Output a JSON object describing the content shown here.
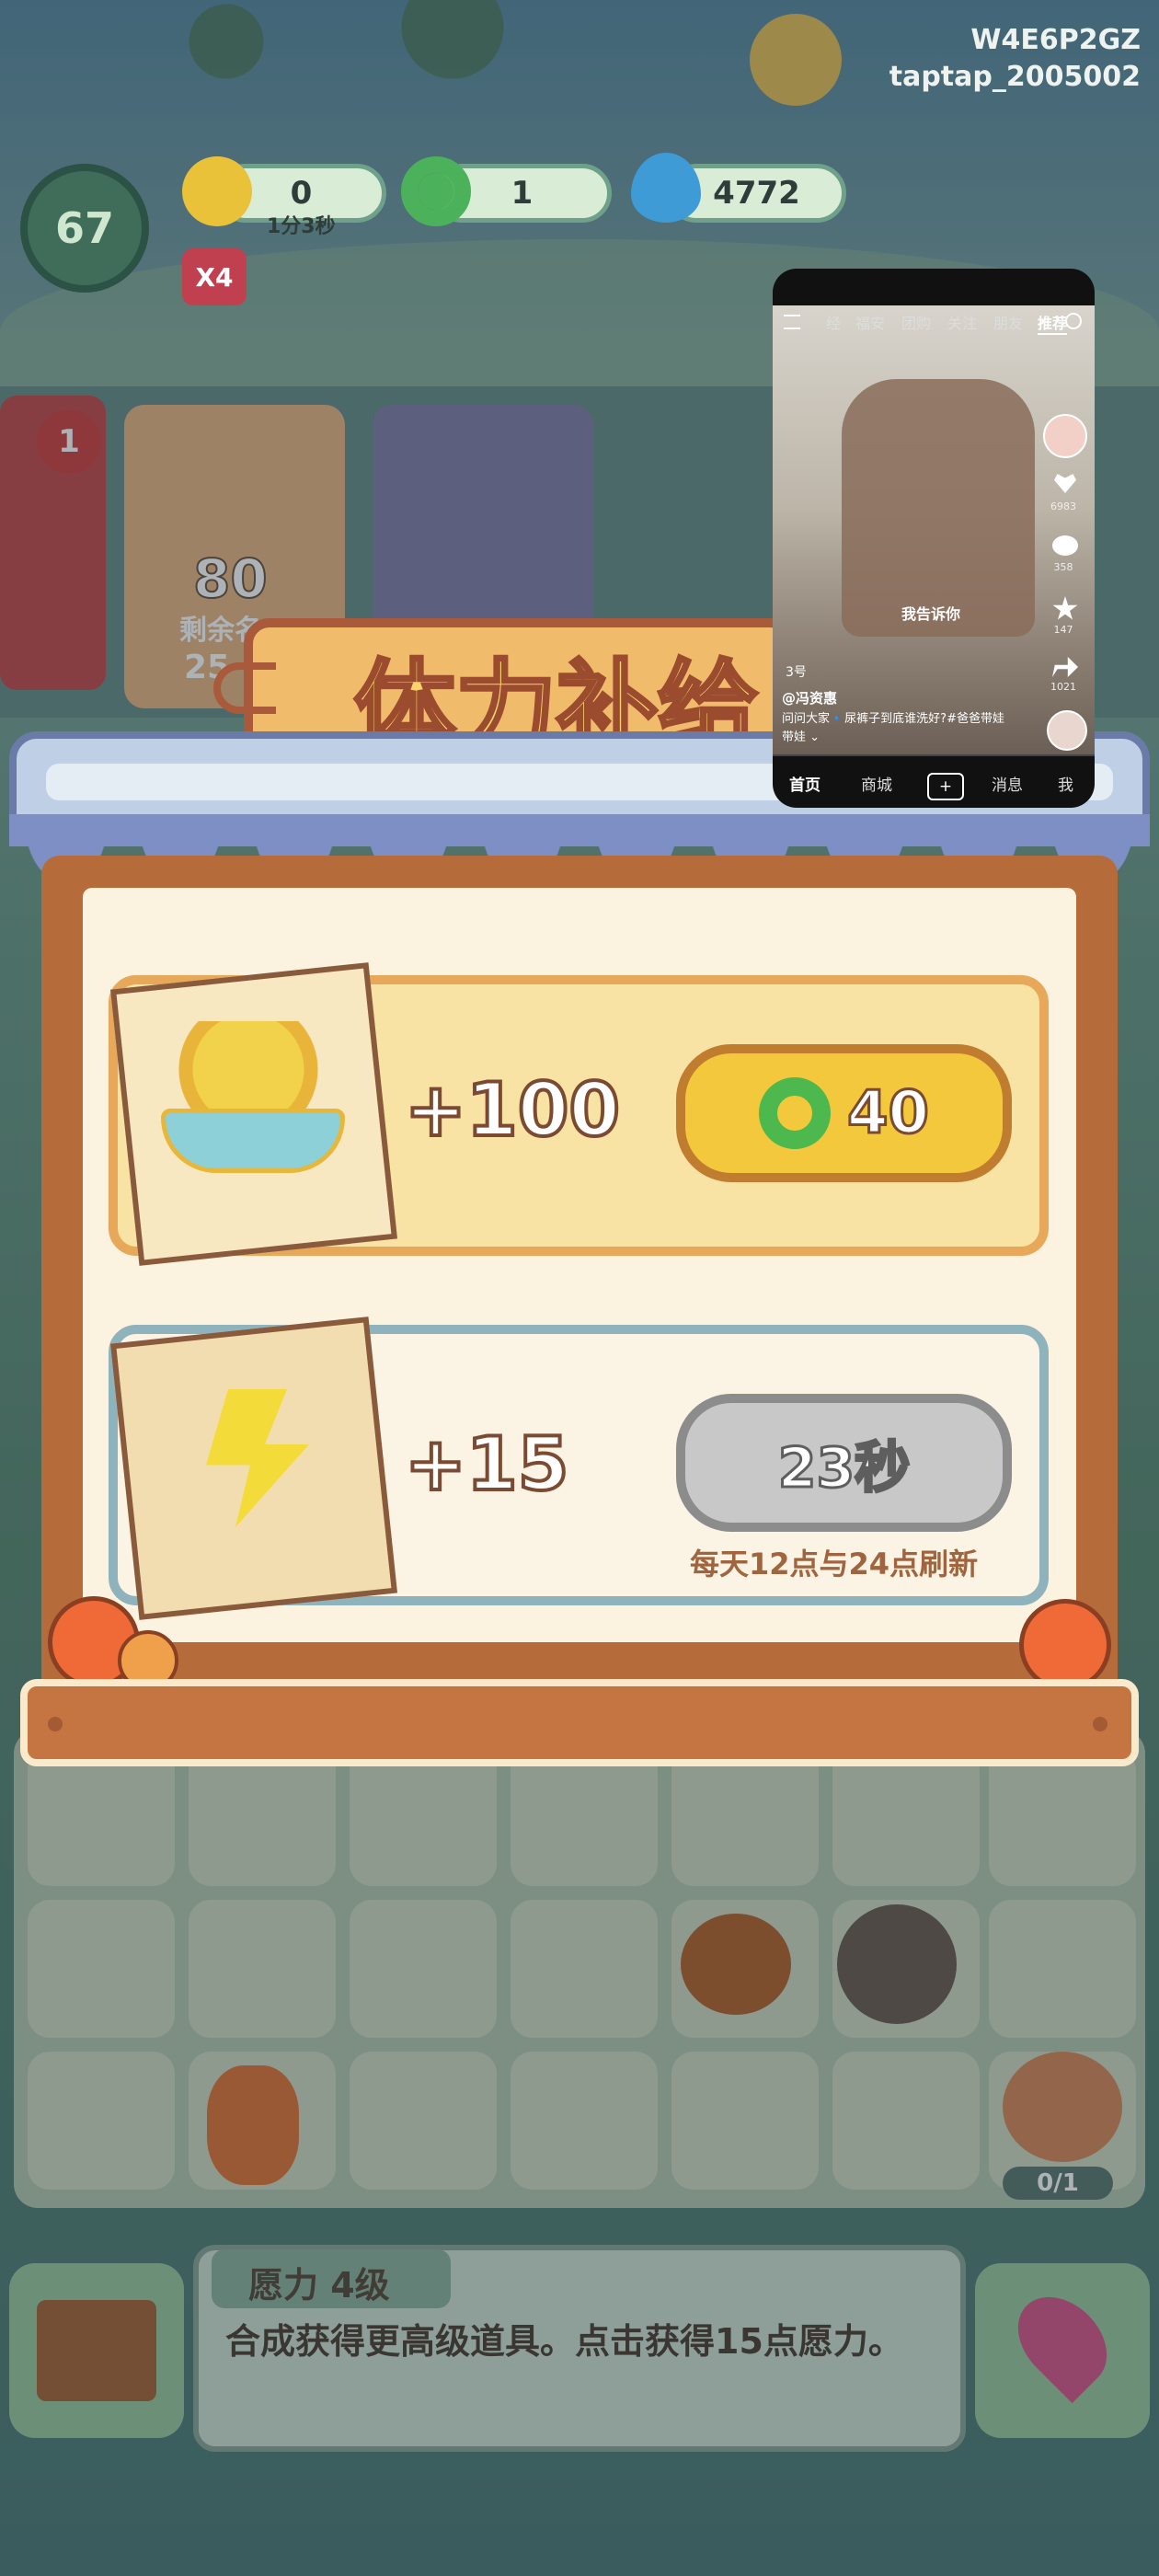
{
  "watermark": {
    "line1": "W4E6P2GZ",
    "line2": "taptap_2005002"
  },
  "hud": {
    "level": "67",
    "energy": "0",
    "energy_timer": "1分3秒",
    "gems": "1",
    "fire": "4772",
    "multiplier": "X4"
  },
  "background": {
    "slot_count": "1",
    "char_number": "80",
    "char_label": "剩余名",
    "char_sub": "25",
    "board_counter": "0/1"
  },
  "dialog": {
    "title": "体力补给",
    "options": [
      {
        "amount": "+100",
        "price": "40",
        "icon": "gem-icon"
      },
      {
        "amount": "+15",
        "timer": "23秒",
        "note": "每天12点与24点刷新"
      }
    ]
  },
  "footer": {
    "level_label": "愿力 4级",
    "hint": "合成获得更高级道具。点击获得15点愿力。"
  },
  "phone": {
    "tabs": [
      "经",
      "福安",
      "团购",
      "关注",
      "朋友",
      "推荐"
    ],
    "active_tab": "推荐",
    "likes": "6983",
    "comments": "358",
    "favorites": "147",
    "shares": "1021",
    "caption_overlay": "我告诉你",
    "author": "@冯资惠",
    "description": "问问大家🔹尿裤子到底谁洗好?#爸爸带娃",
    "description_more": "带娃 ⌄",
    "bottom_nav": [
      "首页",
      "商城",
      "+",
      "消息",
      "我"
    ],
    "text_small": "3号"
  },
  "colors": {
    "panel_brown": "#b66b3a",
    "gold_card": "#f8e2a4",
    "blue_card": "#fbf3df",
    "gold_button": "#f4c83c",
    "gray_button": "#c9c9c9",
    "awning_blue": "#7d8fc4"
  }
}
